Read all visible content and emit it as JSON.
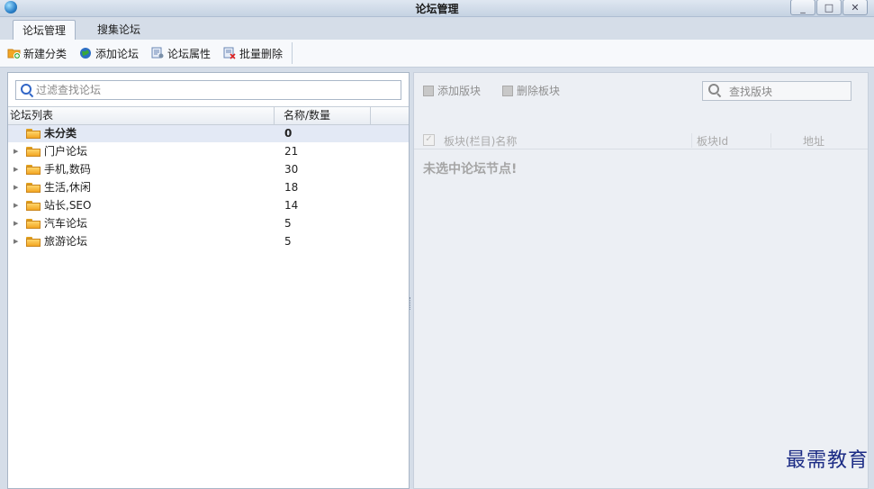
{
  "window": {
    "title": "论坛管理",
    "controls": {
      "minimize": "_",
      "restore": "□",
      "close": "✕"
    }
  },
  "tabs": [
    {
      "label": "论坛管理",
      "active": true
    },
    {
      "label": "搜集论坛",
      "active": false
    }
  ],
  "toolbar": {
    "new_category": "新建分类",
    "add_forum": "添加论坛",
    "forum_properties": "论坛属性",
    "batch_delete": "批量删除"
  },
  "left": {
    "search": {
      "placeholder": "过滤查找论坛",
      "value": ""
    },
    "columns": {
      "list": "论坛列表",
      "name_count": "名称/数量"
    },
    "rows": [
      {
        "name": "未分类",
        "count": "0",
        "selected": true,
        "expandable": false
      },
      {
        "name": "门户论坛",
        "count": "21",
        "expandable": true
      },
      {
        "name": "手机,数码",
        "count": "30",
        "expandable": true
      },
      {
        "name": "生活,休闲",
        "count": "18",
        "expandable": true
      },
      {
        "name": "站长,SEO",
        "count": "14",
        "expandable": true
      },
      {
        "name": "汽车论坛",
        "count": "5",
        "expandable": true
      },
      {
        "name": "旅游论坛",
        "count": "5",
        "expandable": true
      }
    ]
  },
  "right": {
    "add_block": "添加版块",
    "delete_block": "删除板块",
    "search_placeholder": "查找版块",
    "columns": {
      "name": "板块(栏目)名称",
      "id": "板块Id",
      "address": "地址"
    },
    "empty_message": "未选中论坛节点!"
  },
  "watermark": "最需教育",
  "colors": {
    "accent": "#3166c7",
    "folder": "#f2a623",
    "selected_row": "#e3e9f5"
  }
}
